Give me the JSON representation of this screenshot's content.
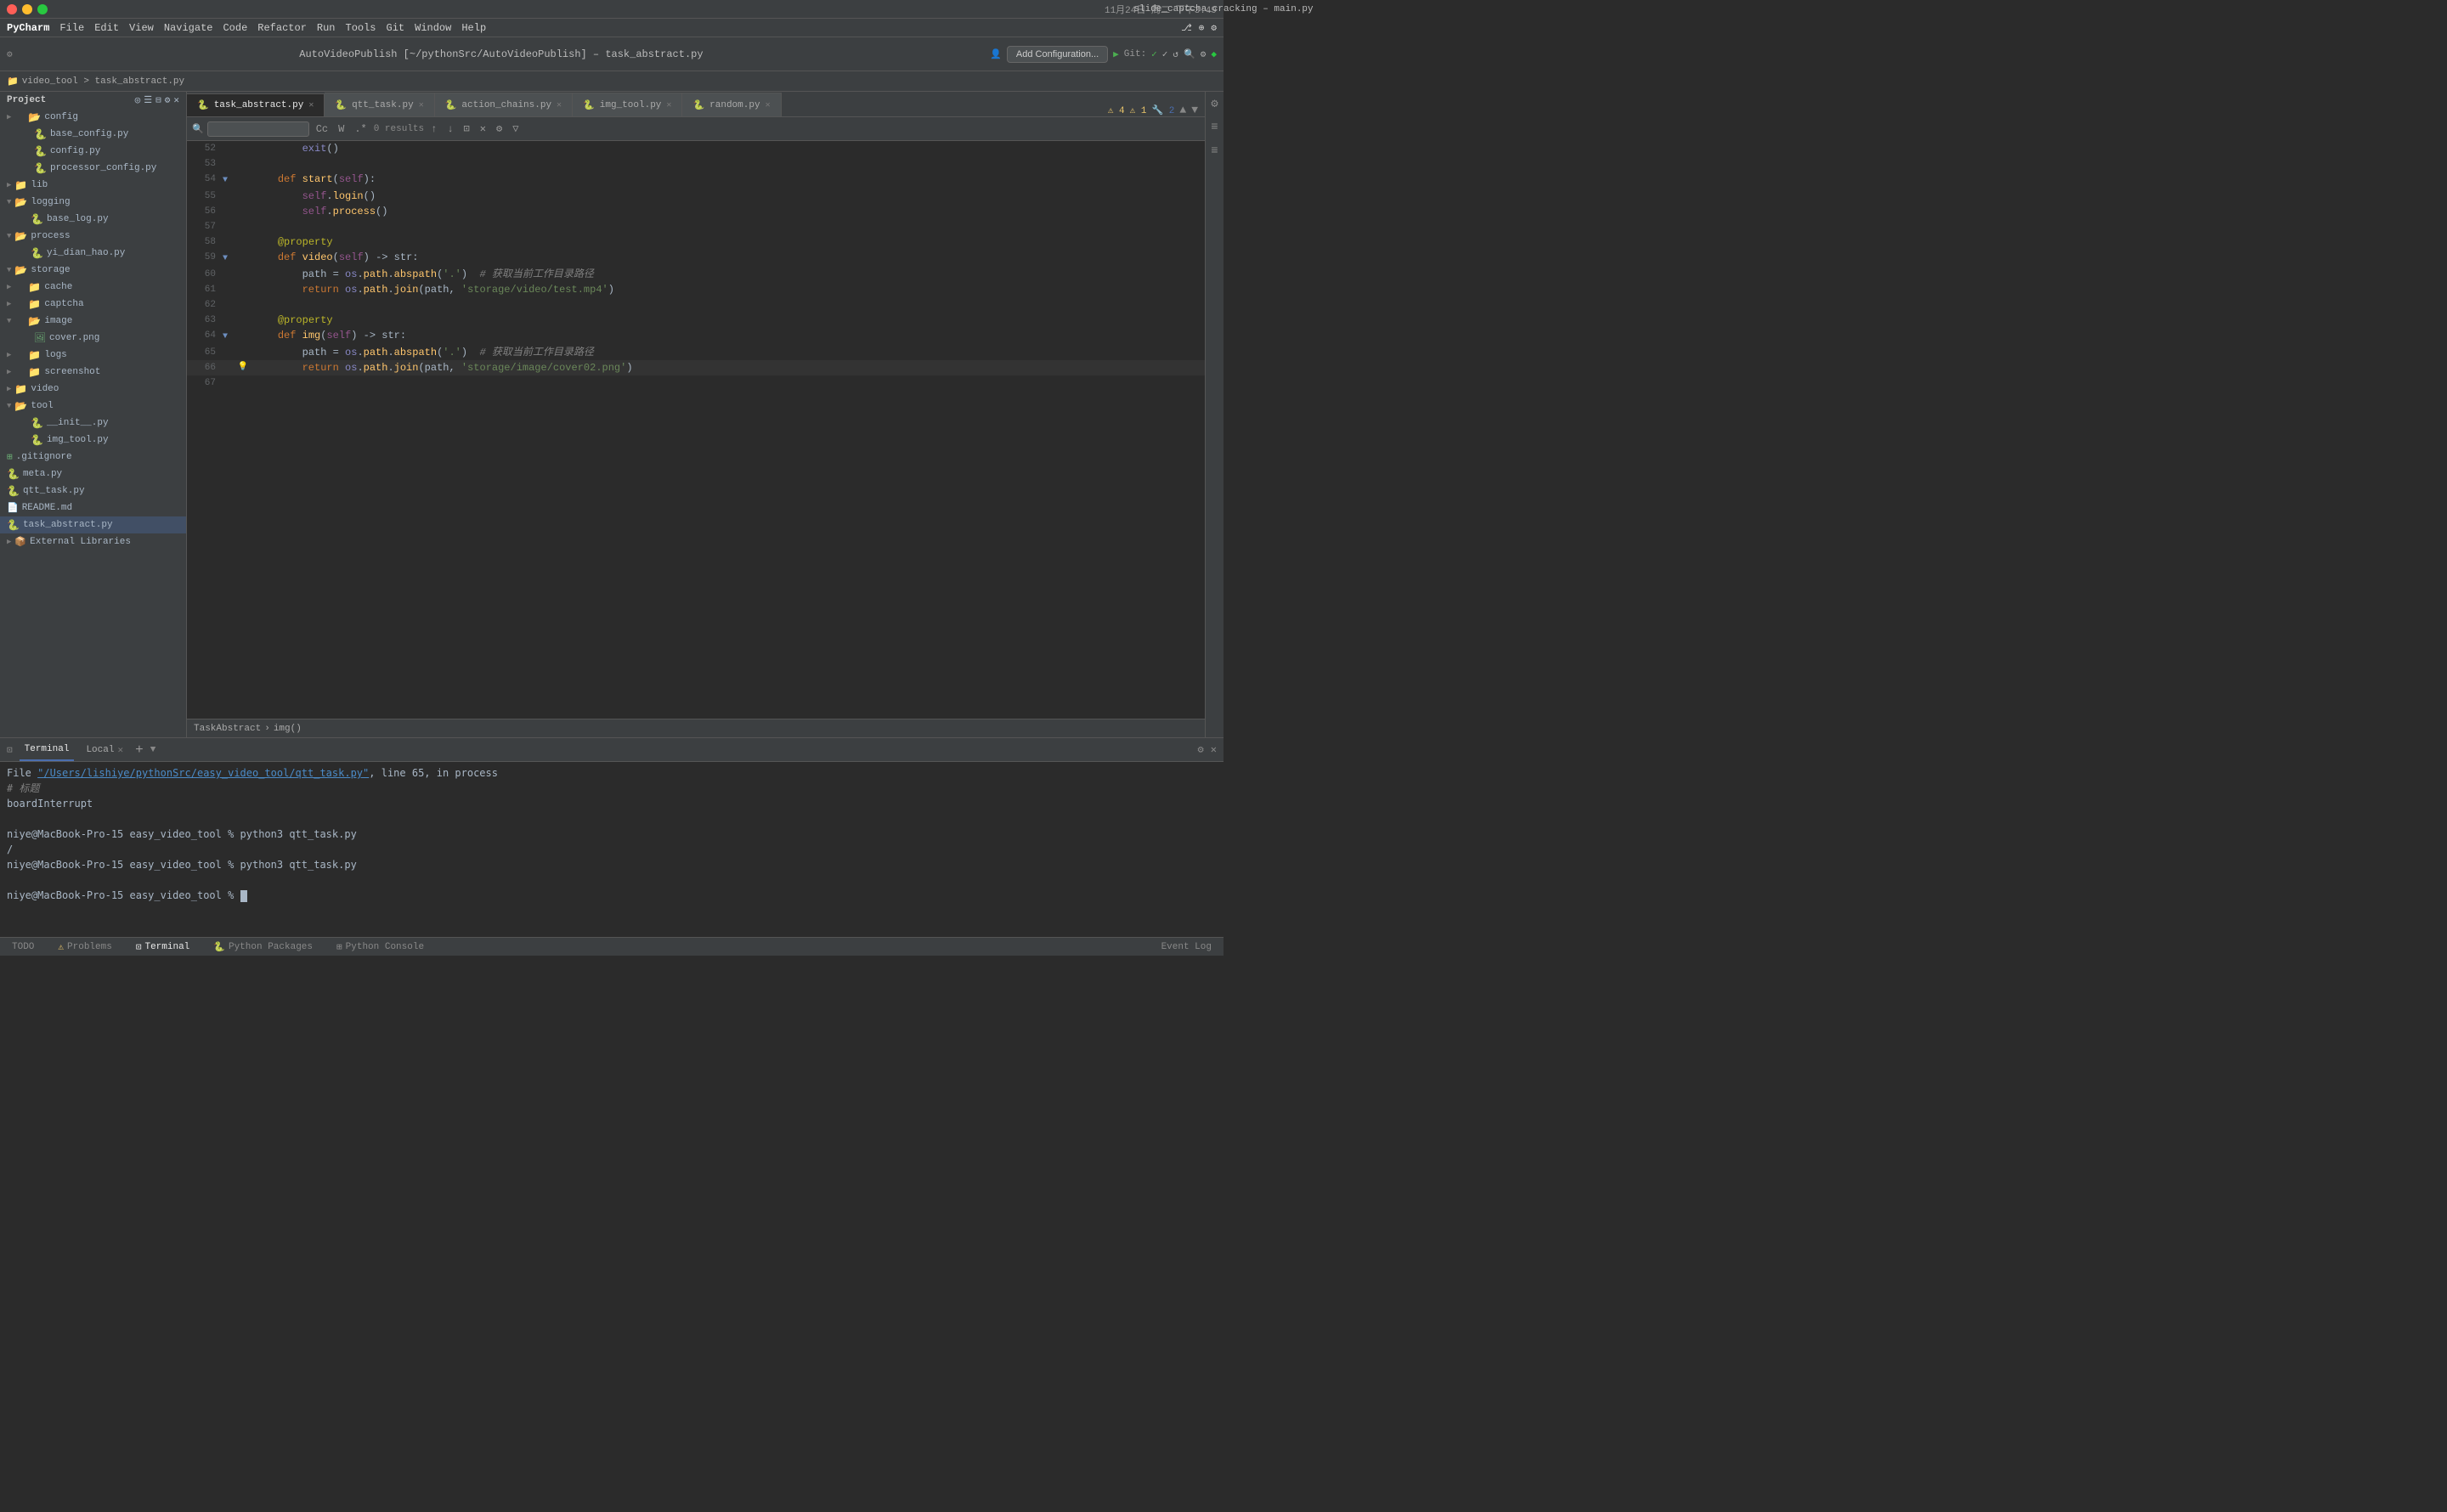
{
  "window": {
    "title": "slide_captcha_cracking – main.py",
    "subtitle": "AutoVideoPublish [~/pythonSrc/AutoVideoPublish] – task_abstract.py"
  },
  "menubar": {
    "app": "PyCharm",
    "items": [
      "File",
      "Edit",
      "View",
      "Navigate",
      "Code",
      "Refactor",
      "Run",
      "Tools",
      "Git",
      "Window",
      "Help"
    ]
  },
  "toolbar": {
    "run_config": "Add Configuration...",
    "git_label": "Git:"
  },
  "breadcrumb": {
    "path": "video_tool  >  task_abstract.py"
  },
  "tabs": [
    {
      "label": "task_abstract.py",
      "active": true,
      "icon": "🐍"
    },
    {
      "label": "qtt_task.py",
      "active": false,
      "icon": "🐍"
    },
    {
      "label": "action_chains.py",
      "active": false,
      "icon": "🐍"
    },
    {
      "label": "img_tool.py",
      "active": false,
      "icon": "🐍"
    },
    {
      "label": "random.py",
      "active": false,
      "icon": "🐍"
    }
  ],
  "search": {
    "placeholder": "🔍",
    "results": "0 results"
  },
  "sidebar": {
    "project_label": "Project",
    "items": [
      {
        "level": 0,
        "type": "folder",
        "label": "config",
        "expanded": false
      },
      {
        "level": 1,
        "type": "file",
        "label": "base_config.py"
      },
      {
        "level": 1,
        "type": "file",
        "label": "config.py"
      },
      {
        "level": 1,
        "type": "file",
        "label": "processor_config.py"
      },
      {
        "level": 0,
        "type": "folder",
        "label": "lib",
        "expanded": false
      },
      {
        "level": 0,
        "type": "folder",
        "label": "logging",
        "expanded": false
      },
      {
        "level": 1,
        "type": "file",
        "label": "base_log.py"
      },
      {
        "level": 0,
        "type": "folder",
        "label": "process",
        "expanded": false
      },
      {
        "level": 1,
        "type": "file",
        "label": "yi_dian_hao.py"
      },
      {
        "level": 0,
        "type": "folder",
        "label": "storage",
        "expanded": true
      },
      {
        "level": 1,
        "type": "folder",
        "label": "cache",
        "expanded": false
      },
      {
        "level": 1,
        "type": "folder",
        "label": "captcha",
        "expanded": false
      },
      {
        "level": 1,
        "type": "folder",
        "label": "image",
        "expanded": true
      },
      {
        "level": 2,
        "type": "file",
        "label": "cover.png"
      },
      {
        "level": 1,
        "type": "folder",
        "label": "logs",
        "expanded": false
      },
      {
        "level": 1,
        "type": "folder",
        "label": "screenshot",
        "expanded": false
      },
      {
        "level": 0,
        "type": "folder",
        "label": "video",
        "expanded": false
      },
      {
        "level": 0,
        "type": "folder",
        "label": "tool",
        "expanded": true
      },
      {
        "level": 1,
        "type": "file",
        "label": "__init__.py"
      },
      {
        "level": 1,
        "type": "file",
        "label": "img_tool.py"
      },
      {
        "level": 0,
        "type": "file-git",
        "label": ".gitignore"
      },
      {
        "level": 0,
        "type": "file",
        "label": "meta.py"
      },
      {
        "level": 0,
        "type": "file",
        "label": "qtt_task.py"
      },
      {
        "level": 0,
        "type": "file-md",
        "label": "README.md"
      },
      {
        "level": 0,
        "type": "file",
        "label": "task_abstract.py",
        "selected": true
      },
      {
        "level": 0,
        "type": "folder-external",
        "label": "External Libraries"
      }
    ]
  },
  "code": {
    "lines": [
      {
        "num": 52,
        "content": "        exit()",
        "has_fold": false,
        "has_bulb": false
      },
      {
        "num": 53,
        "content": "",
        "has_fold": false,
        "has_bulb": false
      },
      {
        "num": 54,
        "content": "    def start(self):",
        "has_fold": true,
        "has_bulb": false
      },
      {
        "num": 55,
        "content": "        self.login()",
        "has_fold": false,
        "has_bulb": false
      },
      {
        "num": 56,
        "content": "        self.process()",
        "has_fold": false,
        "has_bulb": false
      },
      {
        "num": 57,
        "content": "",
        "has_fold": false,
        "has_bulb": false
      },
      {
        "num": 58,
        "content": "    @property",
        "has_fold": false,
        "has_bulb": false
      },
      {
        "num": 59,
        "content": "    def video(self) -> str:",
        "has_fold": true,
        "has_bulb": false
      },
      {
        "num": 60,
        "content": "        path = os.path.abspath('.')  # 获取当前工作目录路径",
        "has_fold": false,
        "has_bulb": false
      },
      {
        "num": 61,
        "content": "        return os.path.join(path, 'storage/video/test.mp4')",
        "has_fold": false,
        "has_bulb": false
      },
      {
        "num": 62,
        "content": "",
        "has_fold": false,
        "has_bulb": false
      },
      {
        "num": 63,
        "content": "    @property",
        "has_fold": false,
        "has_bulb": false
      },
      {
        "num": 64,
        "content": "    def img(self) -> str:",
        "has_fold": true,
        "has_bulb": false
      },
      {
        "num": 65,
        "content": "        path = os.path.abspath('.')  # 获取当前工作目录路径",
        "has_fold": false,
        "has_bulb": false
      },
      {
        "num": 66,
        "content": "        return os.path.join(path, 'storage/image/cover02.png')",
        "has_fold": false,
        "has_bulb": true
      },
      {
        "num": 67,
        "content": "",
        "has_fold": false,
        "has_bulb": false
      }
    ]
  },
  "code_breadcrumb": {
    "path": "TaskAbstract  >  img()"
  },
  "terminal": {
    "tabs": [
      {
        "label": "Terminal",
        "active": true
      },
      {
        "label": "Local",
        "active": false
      }
    ],
    "lines": [
      {
        "text": "File \"/Users/lishiye/pythonSrc/easy_video_tool/qtt_task.py\", line 65, in process",
        "type": "error_link"
      },
      {
        "text": "# 标题",
        "type": "comment"
      },
      {
        "text": "boardInterrupt",
        "type": "normal"
      },
      {
        "text": "",
        "type": "normal"
      },
      {
        "text": "niye@MacBook-Pro-15 easy_video_tool % python3 qtt_task.py",
        "type": "prompt"
      },
      {
        "text": "/",
        "type": "normal"
      },
      {
        "text": "niye@MacBook-Pro-15 easy_video_tool % python3 qtt_task.py",
        "type": "prompt"
      },
      {
        "text": "",
        "type": "normal"
      },
      {
        "text": "niye@MacBook-Pro-15 easy_video_tool % ",
        "type": "prompt_cursor"
      }
    ]
  },
  "statusbar": {
    "items": [
      "TODO",
      "Problems",
      "Terminal",
      "Python Packages",
      "Python Console"
    ],
    "active": "Terminal",
    "right_items": [
      "Event Log"
    ]
  }
}
